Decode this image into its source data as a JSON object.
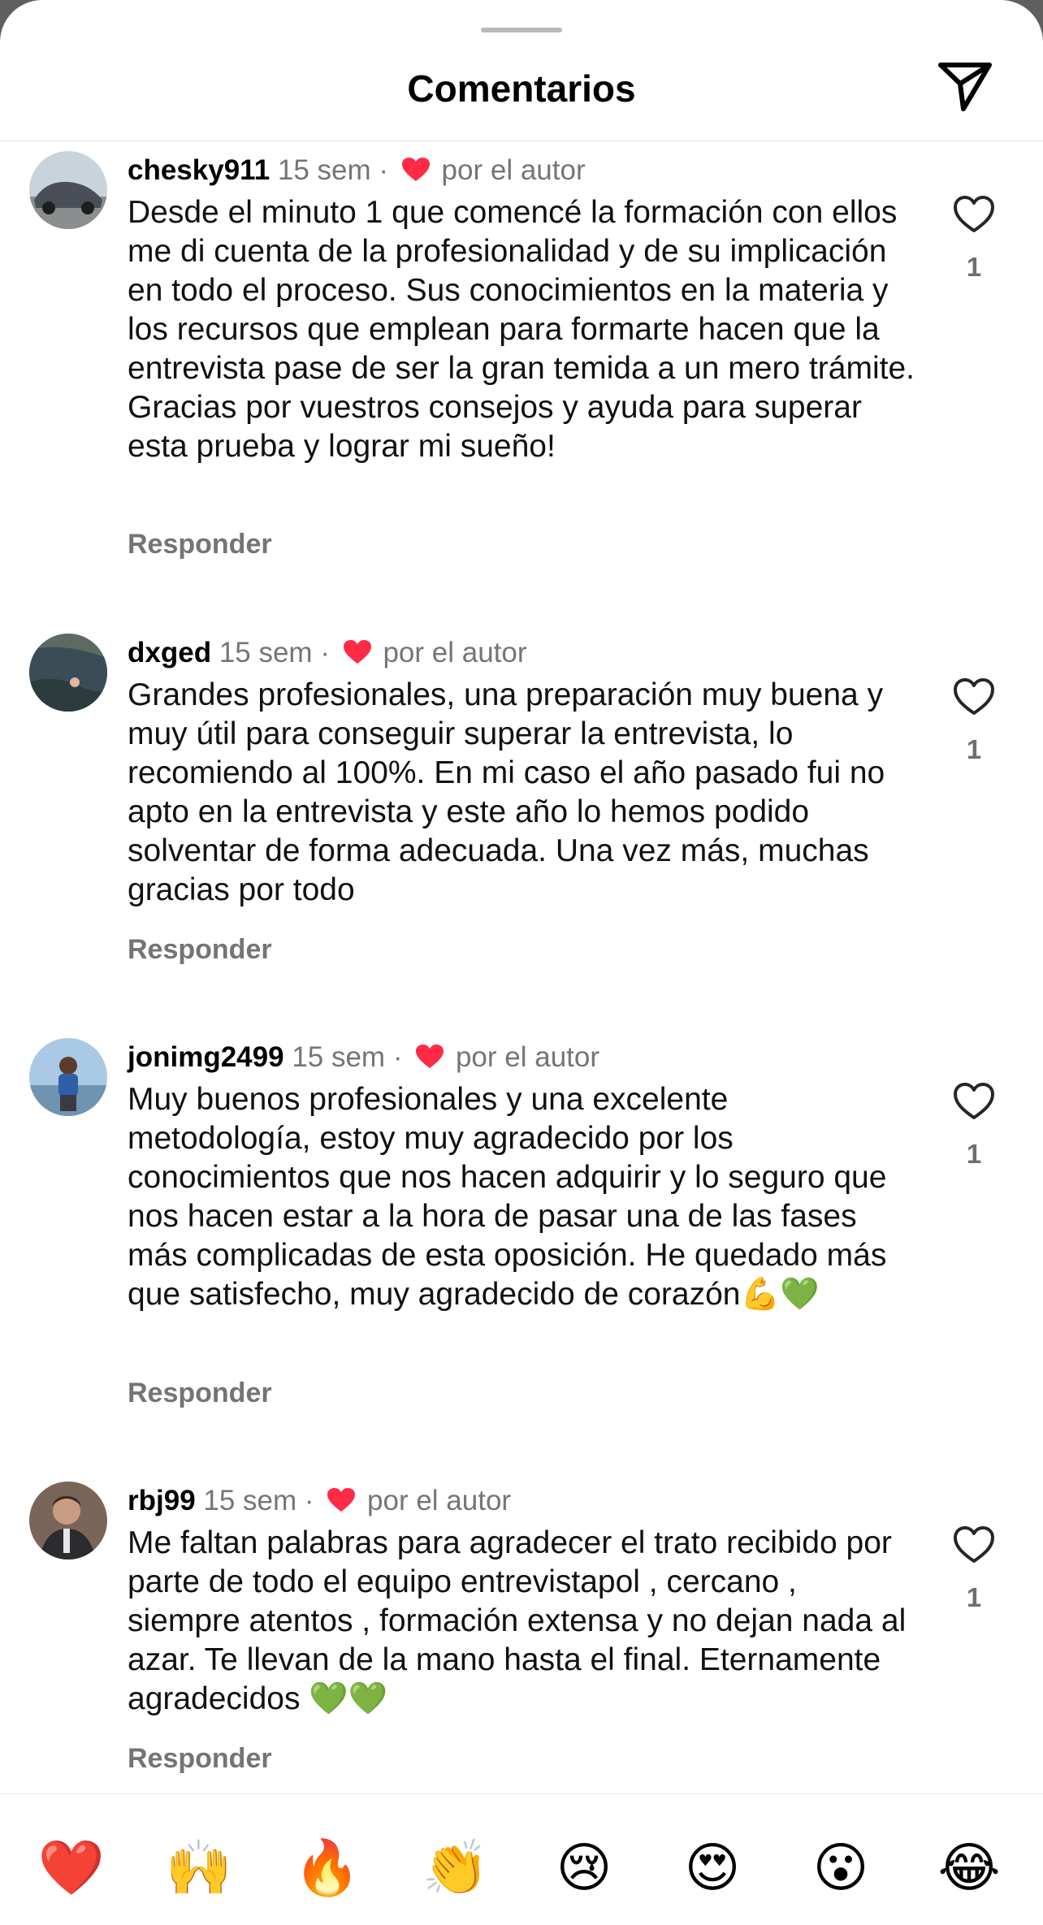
{
  "header": {
    "title": "Comentarios",
    "share_icon": "paper-plane-icon"
  },
  "comments": [
    {
      "username": "chesky911",
      "time": "15 sem",
      "separator": "·",
      "liked_by_author": "por el autor",
      "text": "Desde el minuto 1 que comencé la formación con ellos me di cuenta de la profesionalidad y de su implicación en todo el proceso. Sus conocimientos en la materia y los recursos que emplean para formarte hacen que la entrevista pase de ser la gran temida a un mero trámite. Gracias por vuestros consejos y ayuda para superar esta prueba y lograr mi sueño!",
      "reply_label": "Responder",
      "likes": "1"
    },
    {
      "username": "dxged",
      "time": "15 sem",
      "separator": "·",
      "liked_by_author": "por el autor",
      "text": "Grandes profesionales, una preparación muy buena y muy útil para conseguir superar la entrevista, lo recomiendo al 100%. En mi caso el año pasado fui no apto en la entrevista y este año lo hemos podido solventar de forma adecuada. Una vez más, muchas gracias por todo",
      "reply_label": "Responder",
      "likes": "1"
    },
    {
      "username": "jonimg2499",
      "time": "15 sem",
      "separator": "·",
      "liked_by_author": "por el autor",
      "text": "Muy buenos profesionales y una excelente metodología, estoy muy agradecido por los conocimientos que nos hacen adquirir y lo seguro que nos hacen estar a la hora de pasar una de las fases más complicadas de esta oposición. He quedado más que satisfecho, muy agradecido de corazón💪💚",
      "reply_label": "Responder",
      "likes": "1"
    },
    {
      "username": "rbj99",
      "time": "15 sem",
      "separator": "·",
      "liked_by_author": "por el autor",
      "text": "Me faltan palabras para agradecer el trato recibido por parte de todo el equipo entrevistapol , cercano , siempre atentos , formación extensa y no dejan nada al azar. Te llevan de la mano hasta el final. Eternamente agradecidos 💚💚",
      "reply_label": "Responder",
      "likes": "1"
    }
  ],
  "emoji_bar": [
    "❤️",
    "🙌",
    "🔥",
    "👏",
    "😢",
    "😍",
    "😮",
    "😂"
  ],
  "colors": {
    "author_heart": "#ff2a46",
    "muted_text": "#757575",
    "text": "#111111"
  }
}
